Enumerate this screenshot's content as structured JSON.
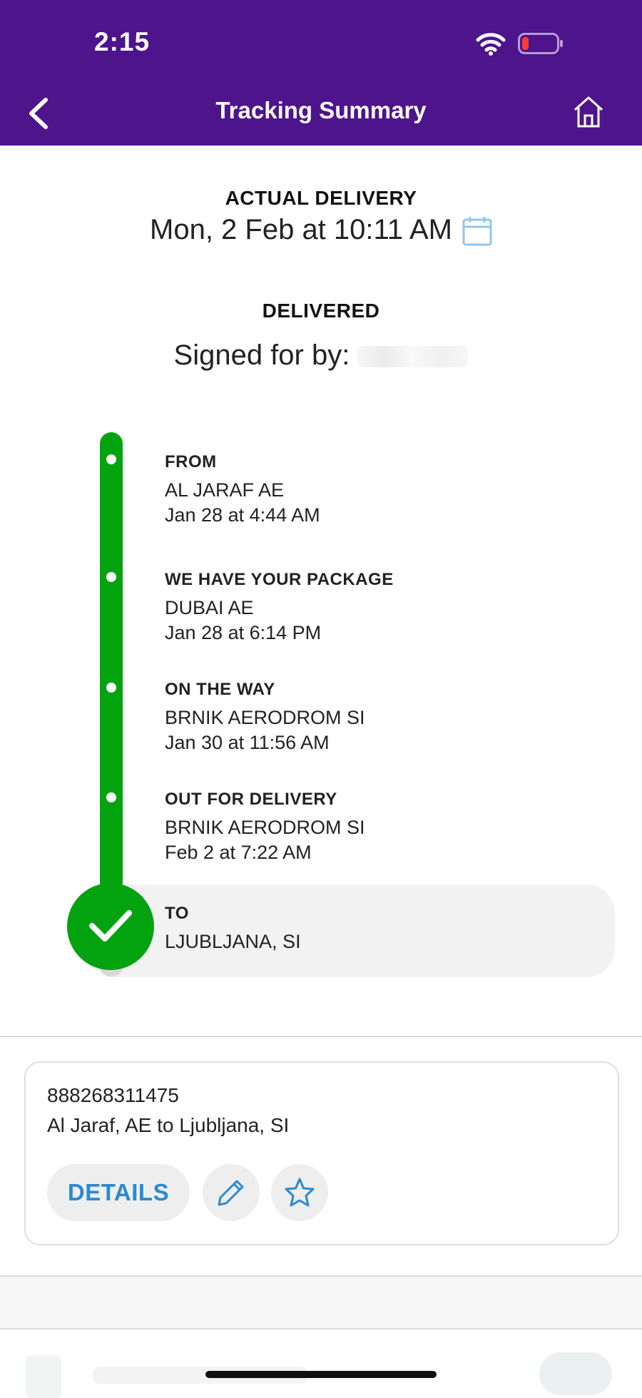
{
  "status_bar": {
    "time": "2:15"
  },
  "header": {
    "title": "Tracking Summary"
  },
  "delivery": {
    "actual_label": "ACTUAL DELIVERY",
    "date": "Mon, 2 Feb at 10:11 AM",
    "status": "DELIVERED",
    "signed_for": "Signed for by:"
  },
  "timeline": {
    "stops": [
      {
        "title": "FROM",
        "location": "AL JARAF AE",
        "time": "Jan 28 at 4:44 AM"
      },
      {
        "title": "WE HAVE YOUR PACKAGE",
        "location": "DUBAI AE",
        "time": "Jan 28 at 6:14 PM"
      },
      {
        "title": "ON THE WAY",
        "location": "BRNIK AERODROM SI",
        "time": "Jan 30 at 11:56 AM"
      },
      {
        "title": "OUT FOR DELIVERY",
        "location": "BRNIK AERODROM SI",
        "time": "Feb 2 at 7:22 AM"
      }
    ],
    "final": {
      "title": "TO",
      "location": "LJUBLJANA, SI"
    }
  },
  "shipment_card": {
    "tracking_number": "888268311475",
    "route": "Al Jaraf, AE to Ljubljana, SI",
    "details_label": "DETAILS"
  },
  "colors": {
    "header": "#4d148c",
    "timeline": "#03a30f",
    "accent": "#2b8ad1"
  },
  "icons": [
    "back-icon",
    "home-icon",
    "calendar-icon",
    "check-icon",
    "pencil-icon",
    "star-icon",
    "wifi-icon",
    "battery-icon"
  ]
}
